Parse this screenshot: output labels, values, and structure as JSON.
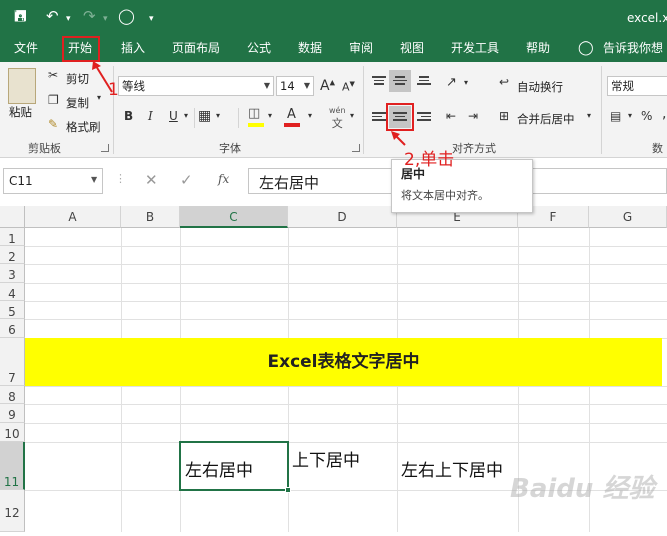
{
  "window": {
    "title": "excel.x"
  },
  "menu": {
    "tabs": [
      "文件",
      "开始",
      "插入",
      "页面布局",
      "公式",
      "数据",
      "审阅",
      "视图",
      "开发工具",
      "帮助"
    ],
    "tell_me": "告诉我你想"
  },
  "clipboard": {
    "paste": "粘贴",
    "cut": "剪切",
    "copy": "复制",
    "format_painter": "格式刷",
    "group": "剪贴板"
  },
  "font": {
    "name": "等线",
    "size": "14",
    "bold": "B",
    "italic": "I",
    "underline": "U",
    "grow": "A",
    "shrink": "A",
    "wen": "wén",
    "wen_char": "文",
    "group": "字体"
  },
  "alignment": {
    "wrap": "自动换行",
    "merge": "合并后居中",
    "group": "对齐方式"
  },
  "number": {
    "format": "常规",
    "pct": "%",
    "comma": ",",
    "group": "数字"
  },
  "tooltip": {
    "title": "居中",
    "desc": "将文本居中对齐。"
  },
  "annotations": {
    "step1": "1",
    "step2": "2,单击"
  },
  "formula_bar": {
    "name_box": "C11",
    "fx": "fx",
    "content": "左右居中"
  },
  "grid": {
    "columns": [
      "A",
      "B",
      "C",
      "D",
      "E",
      "F",
      "G"
    ],
    "rows": [
      "1",
      "2",
      "3",
      "4",
      "5",
      "6",
      "7",
      "8",
      "9",
      "10",
      "11",
      "12"
    ],
    "title_cell": "Excel表格文字居中",
    "c11": "左右居中",
    "d11": "上下居中",
    "e11": "左右上下居中",
    "highlight": "#ffff00"
  },
  "watermark": "Baidu 经验"
}
